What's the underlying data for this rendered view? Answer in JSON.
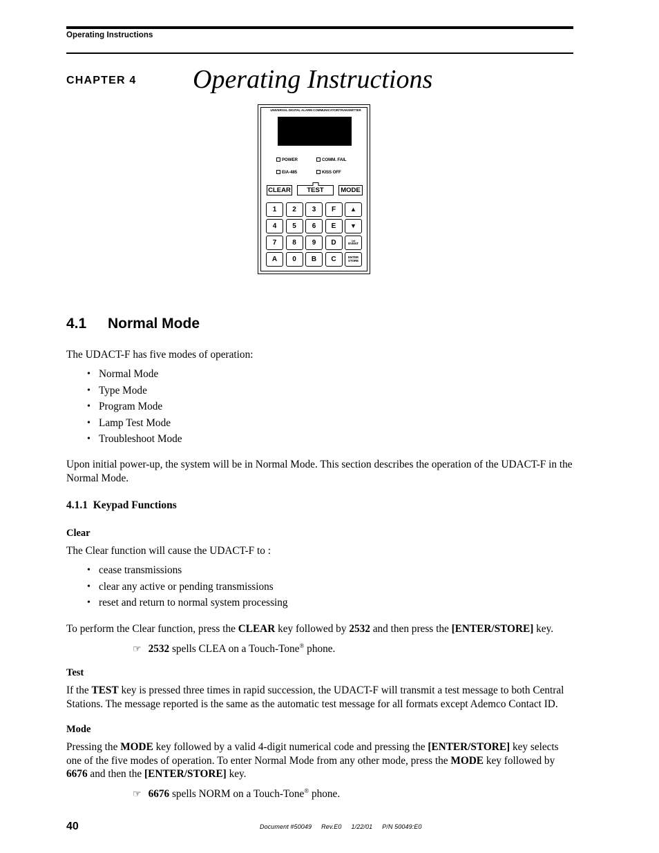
{
  "header": {
    "running_head": "Operating Instructions"
  },
  "chapter": {
    "label": "CHAPTER 4",
    "title": "Operating Instructions"
  },
  "device": {
    "banner": "UNIVERSAL  DIGITAL  ALARM  COMMUNICATOR/TRANSMITTER",
    "leds": [
      {
        "label": "POWER"
      },
      {
        "label": "COMM. FAIL"
      },
      {
        "label": "EIA-485"
      },
      {
        "label": "KISS OFF"
      }
    ],
    "function_keys": [
      {
        "label": "CLEAR"
      },
      {
        "label": "TEST"
      },
      {
        "label": "MODE"
      }
    ],
    "keypad": [
      {
        "label": "1"
      },
      {
        "label": "2"
      },
      {
        "label": "3"
      },
      {
        "label": "F"
      },
      {
        "label": "▲"
      },
      {
        "label": "4"
      },
      {
        "label": "5"
      },
      {
        "label": "6"
      },
      {
        "label": "E"
      },
      {
        "label": "▼"
      },
      {
        "label": "7"
      },
      {
        "label": "8"
      },
      {
        "label": "9"
      },
      {
        "label": "D"
      },
      {
        "label_line1": "1st",
        "label_line2": "EVENT"
      },
      {
        "label": "A"
      },
      {
        "label": "0"
      },
      {
        "label": "B"
      },
      {
        "label": "C"
      },
      {
        "label_line1": "ENTER",
        "label_line2": "STORE"
      }
    ]
  },
  "section_41": {
    "number": "4.1",
    "title": "Normal Mode",
    "intro": "The UDACT-F has five modes of operation:",
    "modes": [
      "Normal Mode",
      "Type Mode",
      "Program Mode",
      "Lamp Test Mode",
      "Troubleshoot Mode"
    ],
    "paragraph": "Upon initial power-up, the system will be in Normal Mode.  This section describes the operation of the UDACT-F in the Normal Mode."
  },
  "section_411": {
    "number": "4.1.1",
    "title": "Keypad Functions",
    "clear": {
      "heading": "Clear",
      "intro": "The Clear function will cause the UDACT-F to :",
      "bullets": [
        "cease transmissions",
        "clear any active or pending transmissions",
        "reset and return to normal system processing"
      ],
      "instruction_1": "To perform the Clear function, press the ",
      "instruction_key_1": "CLEAR",
      "instruction_2": " key followed by ",
      "instruction_code": "2532",
      "instruction_3": " and then press the ",
      "instruction_key_2": "[ENTER/STORE]",
      "instruction_4": " key.",
      "note_code": "2532",
      "note_text_1": " spells CLEA on a Touch-Tone",
      "note_sup": "®",
      "note_text_2": " phone."
    },
    "test": {
      "heading": "Test",
      "text_1": "If the ",
      "key": "TEST",
      "text_2": " key is pressed three times in rapid succession, the UDACT-F will transmit a test message to both Central Stations.  The message reported is the same as the automatic test message for all formats except Ademco Contact ID."
    },
    "mode": {
      "heading": "Mode",
      "text_1": "Pressing the ",
      "key_1": "MODE",
      "text_2": " key followed by a valid 4-digit numerical code and pressing the ",
      "key_2": "[ENTER/STORE]",
      "text_3": " key selects one of the five modes of operation.  To enter Normal Mode from any other mode, press the ",
      "key_3": "MODE",
      "text_4": " key followed by ",
      "code": "6676",
      "text_5": " and then the ",
      "key_4": "[ENTER/STORE]",
      "text_6": " key.",
      "note_code": "6676",
      "note_text_1": " spells NORM on a Touch-Tone",
      "note_sup": "®",
      "note_text_2": " phone."
    }
  },
  "footer": {
    "page_number": "40",
    "document": "Document #50049",
    "revision": "Rev.E0",
    "date": "1/22/01",
    "part_number": "P/N 50049:E0"
  },
  "icons": {
    "hand_pointer": "☞",
    "bullet": "•",
    "arrow_up": "▲",
    "arrow_down": "▼"
  }
}
